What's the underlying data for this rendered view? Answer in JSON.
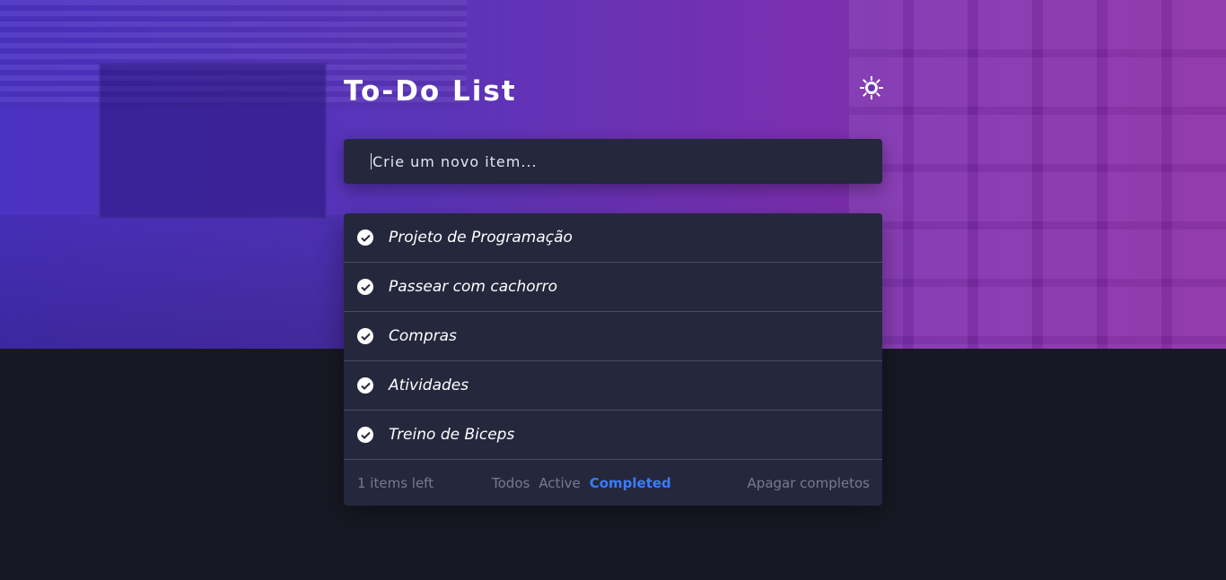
{
  "header": {
    "title": "To-Do List",
    "theme_icon": "sun-icon"
  },
  "new_item": {
    "placeholder": "Crie um novo item..."
  },
  "todos": [
    {
      "text": "Projeto de Programação",
      "completed": true
    },
    {
      "text": "Passear com cachorro",
      "completed": true
    },
    {
      "text": "Compras",
      "completed": true
    },
    {
      "text": "Atividades",
      "completed": true
    },
    {
      "text": "Treino de Biceps",
      "completed": true
    }
  ],
  "footer": {
    "items_left": "1 items left",
    "filters": [
      "Todos",
      "Active",
      "Completed"
    ],
    "active_filter": "Completed",
    "clear_completed": "Apagar completos"
  },
  "colors": {
    "accent": "#3a7bfd",
    "card": "#25273d",
    "page_bg": "#181824"
  }
}
